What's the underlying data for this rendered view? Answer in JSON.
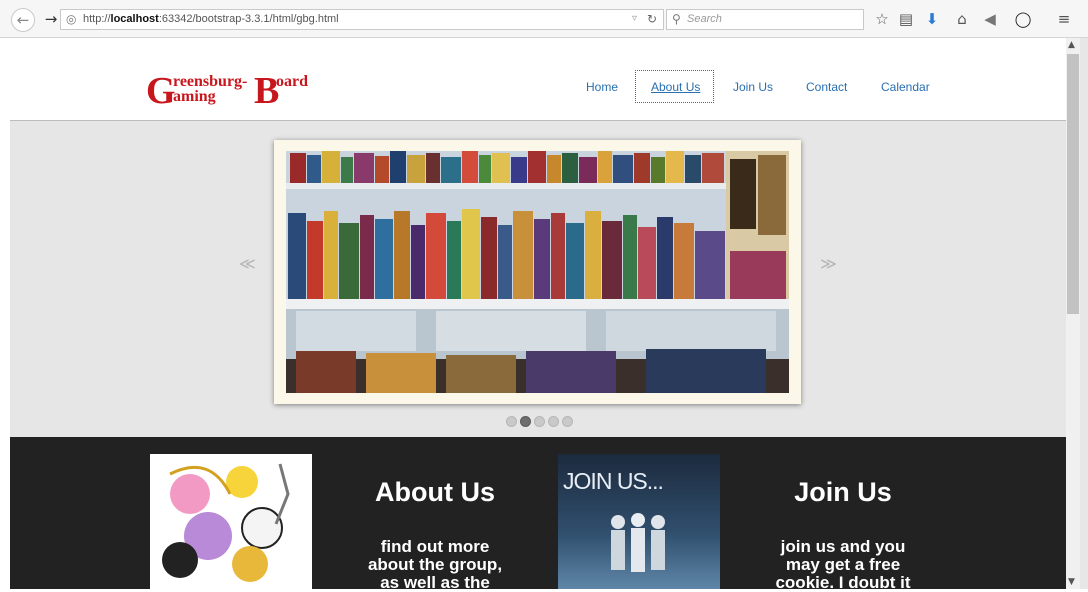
{
  "browser": {
    "url_prefix": "http://",
    "url_host": "localhost",
    "url_rest": ":63342/bootstrap-3.3.1/html/gbg.html",
    "search_placeholder": "Search",
    "icons": [
      "back-icon",
      "forward-icon",
      "globe-icon",
      "reload-icon",
      "search-icon",
      "star-icon",
      "reading-list-icon",
      "download-icon",
      "home-icon",
      "send-icon",
      "pocket-icon",
      "menu-icon"
    ]
  },
  "site": {
    "logo": {
      "line1": "reensburg-",
      "line2": "aming",
      "line3": "oard",
      "initial_g": "G",
      "initial_b": "B"
    },
    "nav": [
      {
        "label": "Home",
        "active": false
      },
      {
        "label": "About Us",
        "active": true
      },
      {
        "label": "Join Us",
        "active": false
      },
      {
        "label": "Contact",
        "active": false
      },
      {
        "label": "Calendar",
        "active": false
      }
    ]
  },
  "carousel": {
    "prev_glyph": "≪",
    "next_glyph": "≫",
    "slide_count": 5,
    "active_slide": 2
  },
  "sections": [
    {
      "heading": "About Us",
      "blurb": [
        "find out more",
        "about the group,",
        "as well as the"
      ]
    },
    {
      "image_text": "JOIN US...",
      "heading": "Join Us",
      "blurb": [
        "join us and you",
        "may get a free",
        "cookie. I doubt it"
      ]
    }
  ],
  "colors": {
    "link": "#2a6fb0",
    "logo_red": "#c8161d",
    "band": "#222222",
    "carousel_bg": "#e6e6e6"
  }
}
